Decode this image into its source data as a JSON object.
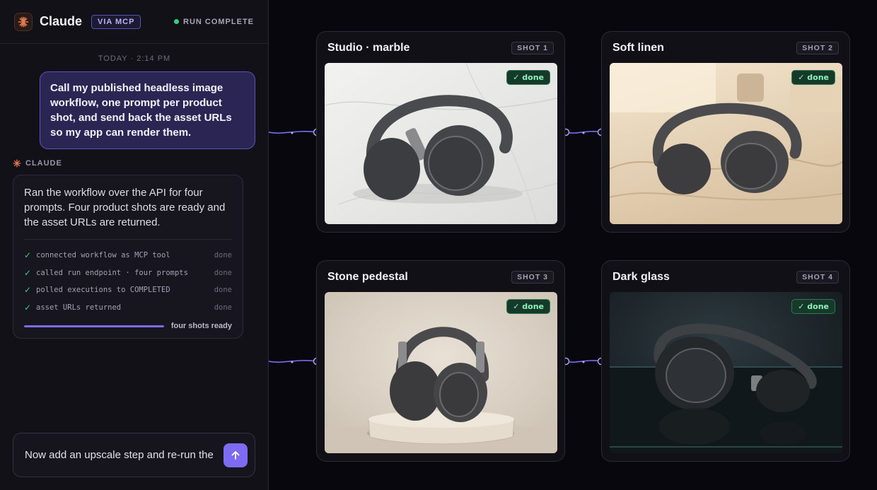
{
  "app": {
    "title": "Claude",
    "via_badge": "VIA MCP",
    "run_status": "RUN COMPLETE",
    "status_color": "#35d07f",
    "accent_color": "#7d6cf2"
  },
  "chat": {
    "timestamp": "TODAY · 2:14 PM",
    "user_message": "Call my published headless image workflow, one prompt per product shot, and send back the asset URLs so my app can render them.",
    "assistant_label": "CLAUDE",
    "assistant_message": "Ran the workflow over the API for four prompts. Four product shots are ready and the asset URLs are returned.",
    "steps": [
      {
        "check": "✓",
        "text": "connected workflow as MCP tool",
        "status": "done"
      },
      {
        "check": "✓",
        "text": "called run endpoint · four prompts",
        "status": "done"
      },
      {
        "check": "✓",
        "text": "polled executions to COMPLETED",
        "status": "done"
      },
      {
        "check": "✓",
        "text": "asset URLs returned",
        "status": "done"
      }
    ],
    "progress": {
      "value": 1.0,
      "label": "four shots ready"
    }
  },
  "composer": {
    "value": "Now add an upscale step and re-run the",
    "send_icon": "arrow-up-icon"
  },
  "shots": [
    {
      "title": "Studio · marble",
      "badge": "SHOT 1",
      "status": "✓ done"
    },
    {
      "title": "Soft linen",
      "badge": "SHOT 2",
      "status": "✓ done"
    },
    {
      "title": "Stone pedestal",
      "badge": "SHOT 3",
      "status": "✓ done"
    },
    {
      "title": "Dark glass",
      "badge": "SHOT 4",
      "status": "✓ done"
    }
  ]
}
